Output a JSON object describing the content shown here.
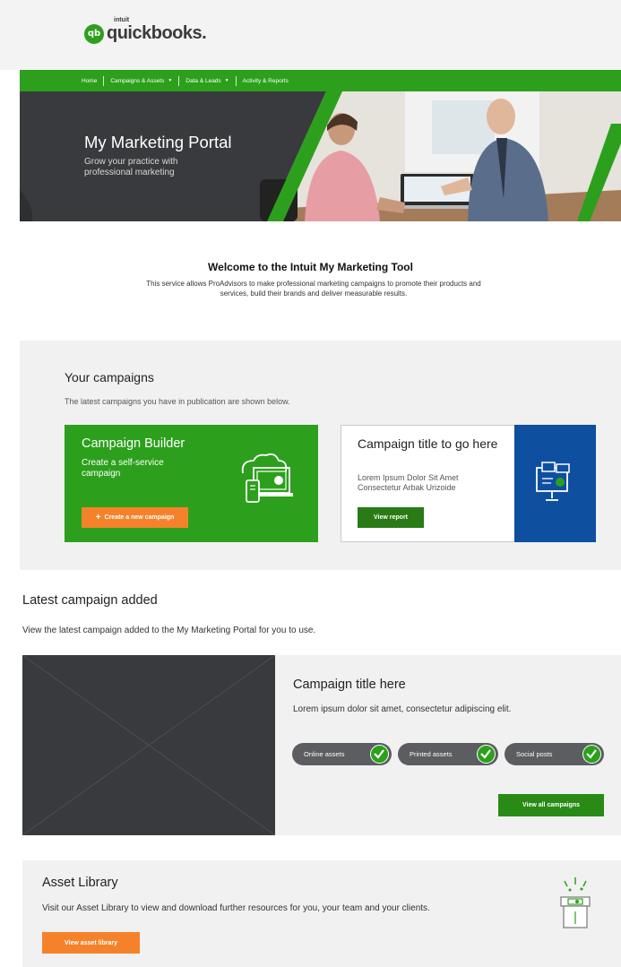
{
  "header": {
    "logo_intuit": "intuit",
    "logo_text": "quickbooks.",
    "logo_mark": "qb"
  },
  "nav": {
    "items": [
      {
        "label": "Home",
        "has_caret": false
      },
      {
        "label": "Campaigns & Assets",
        "has_caret": true
      },
      {
        "label": "Data & Leads",
        "has_caret": true
      },
      {
        "label": "Activity & Reports",
        "has_caret": false
      }
    ]
  },
  "hero": {
    "title": "My Marketing Portal",
    "subtitle": "Grow your practice with professional marketing"
  },
  "welcome": {
    "title": "Welcome to the Intuit My Marketing Tool",
    "body": "This service allows ProAdvisors to make professional marketing campaigns to promote their products and services, build their brands and deliver measurable results."
  },
  "campaigns": {
    "title": "Your campaigns",
    "subtitle": "The latest campaigns you have in publication are shown below.",
    "builder": {
      "title": "Campaign Builder",
      "subtitle": "Create a self-service campaign",
      "button": "Create a new campaign",
      "button_icon": "plus-icon"
    },
    "report_card": {
      "title": "Campaign title to go here",
      "subtitle": "Lorem Ipsum Dolor Sit Amet Consectetur Arbak Urizoide",
      "button": "View report"
    }
  },
  "latest": {
    "title": "Latest campaign added",
    "subtitle": "View the latest campaign added to the My Marketing Portal for you to use.",
    "campaign_title": "Campaign title here",
    "campaign_body": "Lorem ipsum dolor sit amet, consectetur adipiscing elit.",
    "pills": [
      {
        "label": "Online assets",
        "checked": true
      },
      {
        "label": "Printed assets",
        "checked": true
      },
      {
        "label": "Social posts",
        "checked": true
      }
    ],
    "button": "View all campaigns"
  },
  "asset_library": {
    "title": "Asset Library",
    "body": "Visit our Asset Library to view and download further resources for you, your team and your clients.",
    "button": "View asset library"
  },
  "colors": {
    "brand_green": "#2ca01c",
    "dark_green": "#2a7a15",
    "orange": "#f5822a",
    "charcoal": "#393a3d",
    "blue": "#0e4fa0"
  }
}
